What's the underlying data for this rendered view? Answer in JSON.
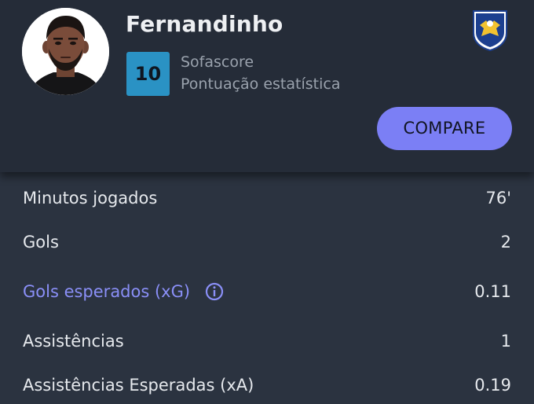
{
  "player": {
    "name": "Fernandinho"
  },
  "rating": {
    "value": "10",
    "source": "Sofascore",
    "label": "Pontuação estatística"
  },
  "actions": {
    "compare_label": "COMPARE"
  },
  "stats": [
    {
      "label": "Minutos jogados",
      "value": "76'",
      "is_link": false
    },
    {
      "label": "Gols",
      "value": "2",
      "is_link": false
    },
    {
      "label": "Gols esperados (xG)",
      "value": "0.11",
      "is_link": true,
      "icon": "info-icon"
    },
    {
      "label": "Assistências",
      "value": "1",
      "is_link": false
    },
    {
      "label": "Assistências Esperadas (xA)",
      "value": "0.19",
      "is_link": false
    }
  ],
  "colors": {
    "background": "#2b3340",
    "header": "#252c38",
    "rating_badge": "#2a92c4",
    "accent": "#7b7ff5",
    "link": "#8a8ff7"
  }
}
